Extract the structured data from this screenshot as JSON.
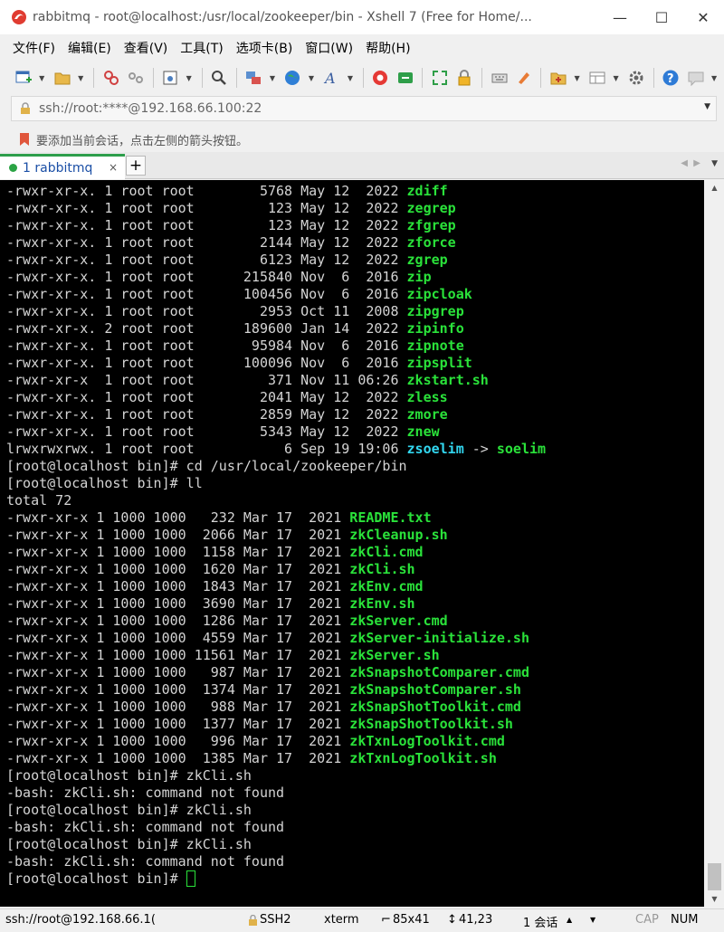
{
  "window": {
    "title": "rabbitmq - root@localhost:/usr/local/zookeeper/bin - Xshell 7 (Free for Home/...",
    "minimize": "—",
    "maximize": "☐",
    "close": "✕"
  },
  "menu": [
    "文件(F)",
    "编辑(E)",
    "查看(V)",
    "工具(T)",
    "选项卡(B)",
    "窗口(W)",
    "帮助(H)"
  ],
  "address": {
    "text": "ssh://root:****@192.168.66.100:22"
  },
  "hint": {
    "text": "要添加当前会话，点击左侧的箭头按钮。"
  },
  "tabs": {
    "active_label": "1 rabbitmq",
    "close": "×",
    "add": "+",
    "prev": "◀",
    "next": "▶",
    "menu": "▼"
  },
  "terminal": {
    "lines": [
      [
        {
          "t": "-rwxr-xr-x. 1 root root        5768 May 12  2022 ",
          "c": "w"
        },
        {
          "t": "zdiff",
          "c": "g"
        }
      ],
      [
        {
          "t": "-rwxr-xr-x. 1 root root         123 May 12  2022 ",
          "c": "w"
        },
        {
          "t": "zegrep",
          "c": "g"
        }
      ],
      [
        {
          "t": "-rwxr-xr-x. 1 root root         123 May 12  2022 ",
          "c": "w"
        },
        {
          "t": "zfgrep",
          "c": "g"
        }
      ],
      [
        {
          "t": "-rwxr-xr-x. 1 root root        2144 May 12  2022 ",
          "c": "w"
        },
        {
          "t": "zforce",
          "c": "g"
        }
      ],
      [
        {
          "t": "-rwxr-xr-x. 1 root root        6123 May 12  2022 ",
          "c": "w"
        },
        {
          "t": "zgrep",
          "c": "g"
        }
      ],
      [
        {
          "t": "-rwxr-xr-x. 1 root root      215840 Nov  6  2016 ",
          "c": "w"
        },
        {
          "t": "zip",
          "c": "g"
        }
      ],
      [
        {
          "t": "-rwxr-xr-x. 1 root root      100456 Nov  6  2016 ",
          "c": "w"
        },
        {
          "t": "zipcloak",
          "c": "g"
        }
      ],
      [
        {
          "t": "-rwxr-xr-x. 1 root root        2953 Oct 11  2008 ",
          "c": "w"
        },
        {
          "t": "zipgrep",
          "c": "g"
        }
      ],
      [
        {
          "t": "-rwxr-xr-x. 2 root root      189600 Jan 14  2022 ",
          "c": "w"
        },
        {
          "t": "zipinfo",
          "c": "g"
        }
      ],
      [
        {
          "t": "-rwxr-xr-x. 1 root root       95984 Nov  6  2016 ",
          "c": "w"
        },
        {
          "t": "zipnote",
          "c": "g"
        }
      ],
      [
        {
          "t": "-rwxr-xr-x. 1 root root      100096 Nov  6  2016 ",
          "c": "w"
        },
        {
          "t": "zipsplit",
          "c": "g"
        }
      ],
      [
        {
          "t": "-rwxr-xr-x  1 root root         371 Nov 11 06:26 ",
          "c": "w"
        },
        {
          "t": "zkstart.sh",
          "c": "g"
        }
      ],
      [
        {
          "t": "-rwxr-xr-x. 1 root root        2041 May 12  2022 ",
          "c": "w"
        },
        {
          "t": "zless",
          "c": "g"
        }
      ],
      [
        {
          "t": "-rwxr-xr-x. 1 root root        2859 May 12  2022 ",
          "c": "w"
        },
        {
          "t": "zmore",
          "c": "g"
        }
      ],
      [
        {
          "t": "-rwxr-xr-x. 1 root root        5343 May 12  2022 ",
          "c": "w"
        },
        {
          "t": "znew",
          "c": "g"
        }
      ],
      [
        {
          "t": "lrwxrwxrwx. 1 root root           6 Sep 19 19:06 ",
          "c": "w"
        },
        {
          "t": "zsoelim",
          "c": "c"
        },
        {
          "t": " -> ",
          "c": "w"
        },
        {
          "t": "soelim",
          "c": "g"
        }
      ],
      [
        {
          "t": "[root@localhost bin]# cd /usr/local/zookeeper/bin",
          "c": "w"
        }
      ],
      [
        {
          "t": "[root@localhost bin]# ll",
          "c": "w"
        }
      ],
      [
        {
          "t": "total 72",
          "c": "w"
        }
      ],
      [
        {
          "t": "-rwxr-xr-x 1 1000 1000   232 Mar 17  2021 ",
          "c": "w"
        },
        {
          "t": "README.txt",
          "c": "g"
        }
      ],
      [
        {
          "t": "-rwxr-xr-x 1 1000 1000  2066 Mar 17  2021 ",
          "c": "w"
        },
        {
          "t": "zkCleanup.sh",
          "c": "g"
        }
      ],
      [
        {
          "t": "-rwxr-xr-x 1 1000 1000  1158 Mar 17  2021 ",
          "c": "w"
        },
        {
          "t": "zkCli.cmd",
          "c": "g"
        }
      ],
      [
        {
          "t": "-rwxr-xr-x 1 1000 1000  1620 Mar 17  2021 ",
          "c": "w"
        },
        {
          "t": "zkCli.sh",
          "c": "g"
        }
      ],
      [
        {
          "t": "-rwxr-xr-x 1 1000 1000  1843 Mar 17  2021 ",
          "c": "w"
        },
        {
          "t": "zkEnv.cmd",
          "c": "g"
        }
      ],
      [
        {
          "t": "-rwxr-xr-x 1 1000 1000  3690 Mar 17  2021 ",
          "c": "w"
        },
        {
          "t": "zkEnv.sh",
          "c": "g"
        }
      ],
      [
        {
          "t": "-rwxr-xr-x 1 1000 1000  1286 Mar 17  2021 ",
          "c": "w"
        },
        {
          "t": "zkServer.cmd",
          "c": "g"
        }
      ],
      [
        {
          "t": "-rwxr-xr-x 1 1000 1000  4559 Mar 17  2021 ",
          "c": "w"
        },
        {
          "t": "zkServer-initialize.sh",
          "c": "g"
        }
      ],
      [
        {
          "t": "-rwxr-xr-x 1 1000 1000 11561 Mar 17  2021 ",
          "c": "w"
        },
        {
          "t": "zkServer.sh",
          "c": "g"
        }
      ],
      [
        {
          "t": "-rwxr-xr-x 1 1000 1000   987 Mar 17  2021 ",
          "c": "w"
        },
        {
          "t": "zkSnapshotComparer.cmd",
          "c": "g"
        }
      ],
      [
        {
          "t": "-rwxr-xr-x 1 1000 1000  1374 Mar 17  2021 ",
          "c": "w"
        },
        {
          "t": "zkSnapshotComparer.sh",
          "c": "g"
        }
      ],
      [
        {
          "t": "-rwxr-xr-x 1 1000 1000   988 Mar 17  2021 ",
          "c": "w"
        },
        {
          "t": "zkSnapShotToolkit.cmd",
          "c": "g"
        }
      ],
      [
        {
          "t": "-rwxr-xr-x 1 1000 1000  1377 Mar 17  2021 ",
          "c": "w"
        },
        {
          "t": "zkSnapShotToolkit.sh",
          "c": "g"
        }
      ],
      [
        {
          "t": "-rwxr-xr-x 1 1000 1000   996 Mar 17  2021 ",
          "c": "w"
        },
        {
          "t": "zkTxnLogToolkit.cmd",
          "c": "g"
        }
      ],
      [
        {
          "t": "-rwxr-xr-x 1 1000 1000  1385 Mar 17  2021 ",
          "c": "w"
        },
        {
          "t": "zkTxnLogToolkit.sh",
          "c": "g"
        }
      ],
      [
        {
          "t": "[root@localhost bin]# zkCli.sh",
          "c": "w"
        }
      ],
      [
        {
          "t": "-bash: zkCli.sh: command not found",
          "c": "w"
        }
      ],
      [
        {
          "t": "[root@localhost bin]# zkCli.sh",
          "c": "w"
        }
      ],
      [
        {
          "t": "-bash: zkCli.sh: command not found",
          "c": "w"
        }
      ],
      [
        {
          "t": "[root@localhost bin]# zkCli.sh",
          "c": "w"
        }
      ],
      [
        {
          "t": "-bash: zkCli.sh: command not found",
          "c": "w"
        }
      ]
    ],
    "prompt": "[root@localhost bin]# ",
    "colors": {
      "fg": "#d4d4d4",
      "exec": "#2ae23a",
      "link": "#32d7f0",
      "bg": "#000000"
    }
  },
  "status": {
    "connection": "ssh://root@192.168.66.1(",
    "protocol": "SSH2",
    "term": "xterm",
    "size": "85x41",
    "cursor_pos": "41,23",
    "sessions": "1 会话",
    "cap": "CAP",
    "num": "NUM"
  }
}
